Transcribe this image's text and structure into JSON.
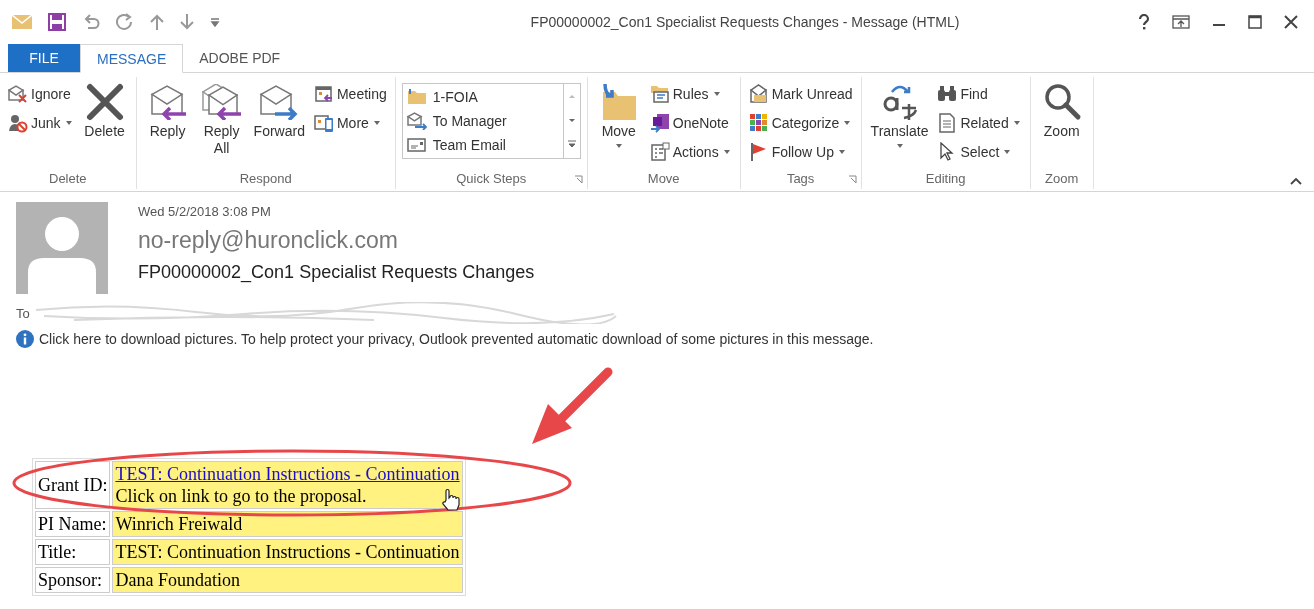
{
  "window": {
    "title": "FP00000002_Con1 Specialist Requests Changes - Message (HTML)"
  },
  "tabs": [
    {
      "label": "FILE",
      "kind": "file",
      "selected": false
    },
    {
      "label": "MESSAGE",
      "kind": "tab",
      "selected": true
    },
    {
      "label": "ADOBE PDF",
      "kind": "tab",
      "selected": false
    }
  ],
  "ribbon": [
    {
      "name": "Delete",
      "launcher": false,
      "columns": [
        {
          "kind": "small",
          "buttons": [
            {
              "label": "Ignore",
              "dropdown": false
            },
            {
              "label": "Junk",
              "dropdown": true
            }
          ]
        },
        {
          "kind": "large",
          "buttons": [
            {
              "label": "Delete",
              "dropdown": false
            }
          ]
        }
      ]
    },
    {
      "name": "Respond",
      "launcher": false,
      "columns": [
        {
          "kind": "large",
          "buttons": [
            {
              "label": "Reply",
              "dropdown": false
            }
          ]
        },
        {
          "kind": "large",
          "buttons": [
            {
              "label": "Reply All",
              "dropdown": false
            }
          ]
        },
        {
          "kind": "large",
          "buttons": [
            {
              "label": "Forward",
              "dropdown": false
            }
          ]
        },
        {
          "kind": "small",
          "buttons": [
            {
              "label": "Meeting",
              "dropdown": false
            },
            {
              "label": "More",
              "dropdown": true
            }
          ]
        }
      ]
    },
    {
      "name": "Quick Steps",
      "launcher": true,
      "columns": [
        {
          "kind": "gallery",
          "buttons": [
            {
              "label": "1-FOIA"
            },
            {
              "label": "To Manager"
            },
            {
              "label": "Team Email"
            }
          ]
        }
      ]
    },
    {
      "name": "Move",
      "launcher": false,
      "columns": [
        {
          "kind": "large",
          "buttons": [
            {
              "label": "Move",
              "dropdown": true
            }
          ]
        },
        {
          "kind": "small",
          "buttons": [
            {
              "label": "Rules",
              "dropdown": true
            },
            {
              "label": "OneNote",
              "dropdown": false
            },
            {
              "label": "Actions",
              "dropdown": true
            }
          ]
        }
      ]
    },
    {
      "name": "Tags",
      "launcher": true,
      "columns": [
        {
          "kind": "small",
          "buttons": [
            {
              "label": "Mark Unread",
              "dropdown": false
            },
            {
              "label": "Categorize",
              "dropdown": true
            },
            {
              "label": "Follow Up",
              "dropdown": true
            }
          ]
        }
      ]
    },
    {
      "name": "Editing",
      "launcher": false,
      "columns": [
        {
          "kind": "large",
          "buttons": [
            {
              "label": "Translate",
              "dropdown": true
            }
          ]
        },
        {
          "kind": "small",
          "buttons": [
            {
              "label": "Find",
              "dropdown": false
            },
            {
              "label": "Related",
              "dropdown": true
            },
            {
              "label": "Select",
              "dropdown": true
            }
          ]
        }
      ]
    },
    {
      "name": "Zoom",
      "launcher": false,
      "columns": [
        {
          "kind": "large",
          "buttons": [
            {
              "label": "Zoom",
              "dropdown": false
            }
          ]
        }
      ]
    }
  ],
  "message": {
    "date": "Wed 5/2/2018 3:08 PM",
    "sender": "no-reply@huronclick.com",
    "subject": "FP00000002_Con1 Specialist Requests Changes",
    "to_label": "To",
    "info_bar": "Click here to download pictures. To help protect your privacy, Outlook prevented automatic download of some pictures in this message."
  },
  "body_table": [
    {
      "label": "Grant ID:",
      "value": "TEST: Continuation Instructions - Continuation",
      "link": true,
      "note": "Click on link to go to the proposal."
    },
    {
      "label": "PI Name:",
      "value": "Winrich Freiwald",
      "link": false
    },
    {
      "label": "Title:",
      "value": "TEST: Continuation Instructions - Continuation",
      "link": false
    },
    {
      "label": "Sponsor:",
      "value": "Dana Foundation",
      "link": false
    }
  ]
}
